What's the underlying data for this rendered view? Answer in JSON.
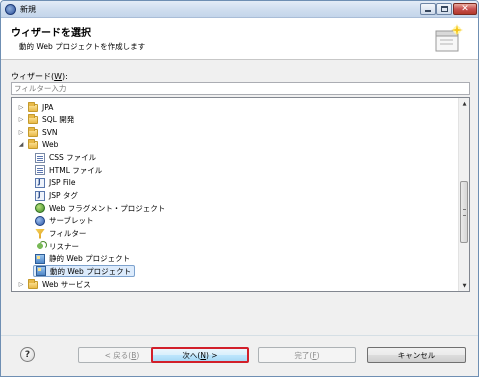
{
  "window": {
    "title": "新規"
  },
  "banner": {
    "title": "ウィザードを選択",
    "description": "動的 Web プロジェクトを作成します"
  },
  "wizards": {
    "label_prefix": "ウィザード(",
    "label_mnemonic": "W",
    "label_suffix": "):",
    "filter_placeholder": "フィルター入力"
  },
  "tree": {
    "items": [
      {
        "label": "JPA",
        "icon": "folder-icon",
        "twisty": "▷",
        "level": 0
      },
      {
        "label": "SQL 開発",
        "icon": "folder-icon",
        "twisty": "▷",
        "level": 0
      },
      {
        "label": "SVN",
        "icon": "folder-icon",
        "twisty": "▷",
        "level": 0
      },
      {
        "label": "Web",
        "icon": "folder-icon",
        "twisty": "◢",
        "level": 0
      },
      {
        "label": "CSS ファイル",
        "icon": "file-icon",
        "level": 1
      },
      {
        "label": "HTML ファイル",
        "icon": "file-icon",
        "level": 1
      },
      {
        "label": "JSP File",
        "icon": "jsp-icon",
        "level": 1
      },
      {
        "label": "JSP タグ",
        "icon": "jsp-icon",
        "level": 1
      },
      {
        "label": "Web フラグメント・プロジェクト",
        "icon": "web-icon",
        "level": 1
      },
      {
        "label": "サーブレット",
        "icon": "servlet-icon",
        "level": 1
      },
      {
        "label": "フィルター",
        "icon": "filter-icon",
        "level": 1
      },
      {
        "label": "リスナー",
        "icon": "listener-icon",
        "level": 1
      },
      {
        "label": "静的 Web プロジェクト",
        "icon": "proj-icon",
        "level": 1
      },
      {
        "label": "動的 Web プロジェクト",
        "icon": "proj-icon",
        "level": 1,
        "selected": true
      },
      {
        "label": "Web サービス",
        "icon": "folder-icon",
        "twisty": "▷",
        "level": 0
      }
    ]
  },
  "buttons": {
    "help": "?",
    "back_prefix": "< 戻る(",
    "back_mnemonic": "B",
    "back_suffix": ")",
    "next_prefix": "次へ(",
    "next_mnemonic": "N",
    "next_suffix": ") >",
    "finish_prefix": "完了(",
    "finish_mnemonic": "F",
    "finish_suffix": ")",
    "cancel": "キャンセル"
  },
  "colors": {
    "selection_bg": "#dcebfc",
    "next_highlight": "#d21f2a"
  }
}
